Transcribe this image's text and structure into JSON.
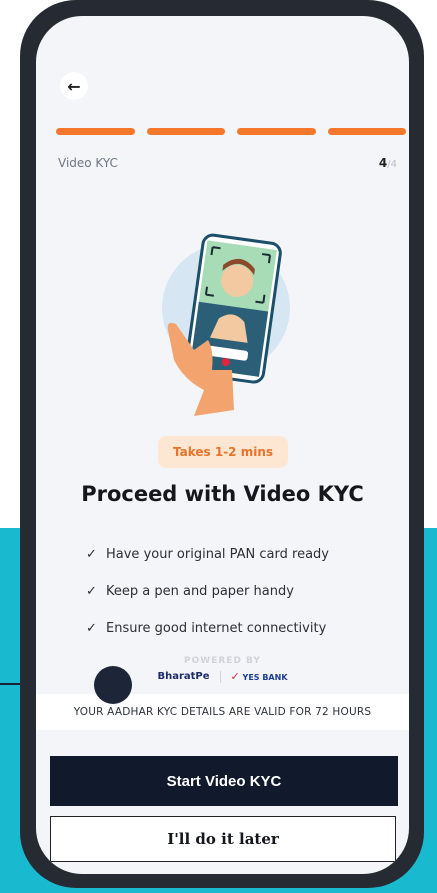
{
  "header": {
    "back_icon": "arrow-left-icon",
    "step_label": "Video KYC",
    "step_current": "4",
    "step_total": "/4",
    "progress_segments": 4,
    "progress_filled": 4,
    "accent_color": "#f4772b"
  },
  "main": {
    "duration_badge": "Takes 1-2 mins",
    "title": "Proceed with Video KYC",
    "checklist": [
      "Have your original PAN card ready",
      "Keep a pen and paper handy",
      "Ensure good internet connectivity"
    ],
    "check_icon": "check-icon"
  },
  "footer": {
    "powered_by": "POWERED BY",
    "brand_bharatpe": "BharatPe",
    "brand_yesbank": "YES BANK",
    "notice": "YOUR AADHAR KYC DETAILS ARE VALID FOR 72 HOURS",
    "primary_button": "Start Video KYC",
    "secondary_button": "I'll do it later"
  },
  "colors": {
    "background_teal": "#19b9cf",
    "primary_button_bg": "#111a2c",
    "badge_bg": "#fde7d3"
  }
}
